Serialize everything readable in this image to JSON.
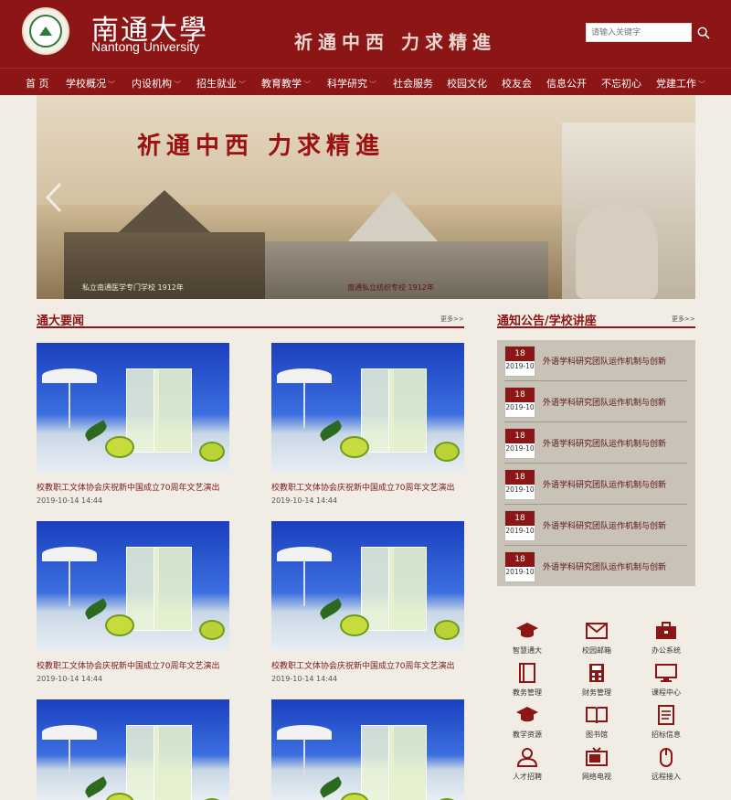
{
  "header": {
    "logo_cn": "南通大學",
    "logo_en": "Nantong University",
    "slogan": "祈通中西  力求精進",
    "search_placeholder": "请输入关键字"
  },
  "nav": [
    {
      "label": "首 页",
      "has_dropdown": false
    },
    {
      "label": "学校概况",
      "has_dropdown": true
    },
    {
      "label": "内设机构",
      "has_dropdown": true
    },
    {
      "label": "招生就业",
      "has_dropdown": true
    },
    {
      "label": "教育教学",
      "has_dropdown": true
    },
    {
      "label": "科学研究",
      "has_dropdown": true
    },
    {
      "label": "社会服务",
      "has_dropdown": false
    },
    {
      "label": "校园文化",
      "has_dropdown": false
    },
    {
      "label": "校友会",
      "has_dropdown": false
    },
    {
      "label": "信息公开",
      "has_dropdown": false
    },
    {
      "label": "不忘初心",
      "has_dropdown": false
    },
    {
      "label": "党建工作",
      "has_dropdown": true
    }
  ],
  "banner": {
    "slogan": "祈通中西  力求精進",
    "caption_left": "私立南通医学专门学校 1912年",
    "caption_right": "南通私立纺织专校 1912年"
  },
  "news": {
    "title": "通大要闻",
    "more": "更多>>",
    "items": [
      {
        "title": "校教职工文体协会庆祝新中国成立70周年文艺演出",
        "date": "2019-10-14 14:44"
      },
      {
        "title": "校教职工文体协会庆祝新中国成立70周年文艺演出",
        "date": "2019-10-14 14:44"
      },
      {
        "title": "校教职工文体协会庆祝新中国成立70周年文艺演出",
        "date": "2019-10-14 14:44"
      },
      {
        "title": "校教职工文体协会庆祝新中国成立70周年文艺演出",
        "date": "2019-10-14 14:44"
      },
      {
        "title": "",
        "date": ""
      },
      {
        "title": "",
        "date": ""
      }
    ]
  },
  "notices": {
    "title": "通知公告/学校讲座",
    "more": "更多>>",
    "items": [
      {
        "day": "18",
        "ym": "2019-10",
        "title": "外语学科研究团队运作机制与创新"
      },
      {
        "day": "18",
        "ym": "2019-10",
        "title": "外语学科研究团队运作机制与创新"
      },
      {
        "day": "18",
        "ym": "2019-10",
        "title": "外语学科研究团队运作机制与创新"
      },
      {
        "day": "18",
        "ym": "2019-10",
        "title": "外语学科研究团队运作机制与创新"
      },
      {
        "day": "18",
        "ym": "2019-10",
        "title": "外语学科研究团队运作机制与创新"
      },
      {
        "day": "18",
        "ym": "2019-10",
        "title": "外语学科研究团队运作机制与创新"
      }
    ]
  },
  "quick_links": [
    {
      "label": "智慧通大",
      "icon": "graduation-cap-icon"
    },
    {
      "label": "校园邮箱",
      "icon": "mail-icon"
    },
    {
      "label": "办公系统",
      "icon": "briefcase-icon"
    },
    {
      "label": "教务管理",
      "icon": "book-icon"
    },
    {
      "label": "财务管理",
      "icon": "calculator-icon"
    },
    {
      "label": "课程中心",
      "icon": "monitor-icon"
    },
    {
      "label": "教学资源",
      "icon": "graduation-cap-icon"
    },
    {
      "label": "图书馆",
      "icon": "open-book-icon"
    },
    {
      "label": "招标信息",
      "icon": "document-icon"
    },
    {
      "label": "人才招聘",
      "icon": "user-icon"
    },
    {
      "label": "网络电视",
      "icon": "tv-icon"
    },
    {
      "label": "远程接入",
      "icon": "mouse-icon"
    }
  ],
  "colors": {
    "brand_red": "#8c1515",
    "page_bg": "#f1ece4",
    "notice_bg": "#c9c2b7"
  }
}
